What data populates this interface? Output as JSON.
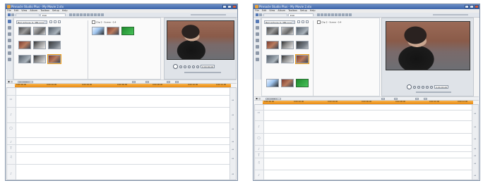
{
  "panels": [
    {
      "title": "Pinnacle Studio Plus - My Movie 2.stx",
      "menu": [
        "File",
        "Edit",
        "View",
        "Album",
        "Toolbox",
        "Setup",
        "Help"
      ],
      "tab_label": "Edit",
      "album": {
        "folder": "Bad pictures to 386 long",
        "check_label": "Clip 2 - Scene - 0.4"
      },
      "player": {
        "timecode": "0:00:00.00"
      },
      "timeline": {
        "title": "My Movie 2",
        "ticks": [
          "0:00:00.00",
          "0:00:02.00",
          "0:00:04.00",
          "0:00:06.00",
          "0:00:08.00",
          "0:00:10.00",
          "0:00:12.00"
        ]
      }
    },
    {
      "title": "Pinnacle Studio Plus - My Movie 2.stx",
      "menu": [
        "File",
        "Edit",
        "View",
        "Album",
        "Toolbox",
        "Setup",
        "Help"
      ],
      "tab_label": "Edit",
      "album": {
        "folder": "Bad pictures to 386 long",
        "check_label": "Clip 2 - Scene - 0.4"
      },
      "player": {
        "timecode": "0:00:00.00"
      },
      "timeline": {
        "title": "My Movie 2",
        "ticks": [
          "0:00:00.00",
          "0:00:02.00",
          "0:00:04.00",
          "0:00:06.00",
          "0:00:08.00",
          "0:00:10.00",
          "0:00:12.00"
        ]
      }
    }
  ],
  "colors": {
    "titlebar": "#3d64a8",
    "ruler": "#ea8a10",
    "green_screen": "#2c9b3a"
  }
}
